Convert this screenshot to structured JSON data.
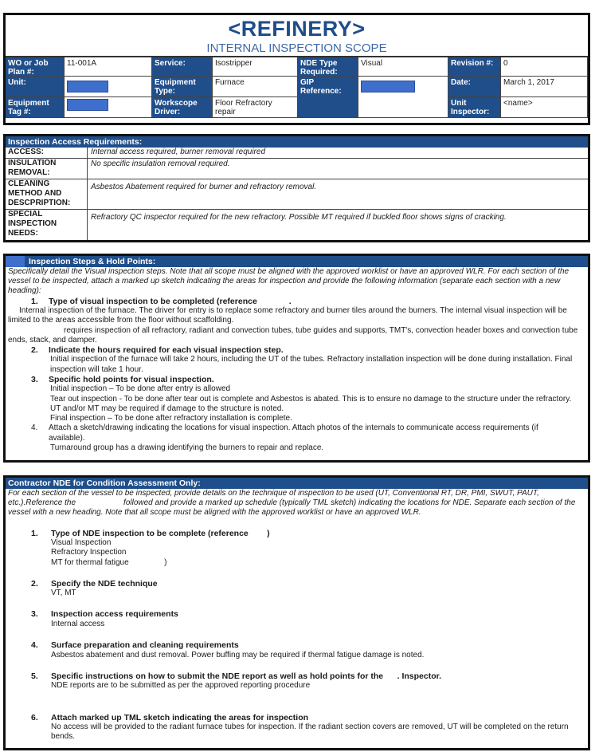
{
  "header": {
    "title": "<REFINERY>",
    "subtitle": "INTERNAL INSPECTION SCOPE",
    "fields": {
      "wo_label": "WO or Job Plan #:",
      "wo_value": "11-001A",
      "service_label": "Service:",
      "service_value": "Isostripper",
      "nde_type_label": "NDE Type Required:",
      "nde_type_value": "Visual",
      "revision_label": "Revision #:",
      "revision_value": "0",
      "unit_label": "Unit:",
      "unit_value": "[redacted]",
      "equipment_type_label": "Equipment Type:",
      "equipment_type_value": "Furnace",
      "gip_label": "GIP Reference:",
      "gip_value": "[redacted]",
      "date_label": "Date:",
      "date_value": "March 1, 2017",
      "equipment_tag_label": "Equipment Tag #:",
      "equipment_tag_value": "[redacted]",
      "workscope_label": "Workscope Driver:",
      "workscope_value": "Floor Refractory repair",
      "unit_inspector_label": "Unit Inspector:",
      "unit_inspector_value": "<name>"
    }
  },
  "access": {
    "title": "Inspection Access Requirements:",
    "rows": [
      {
        "label": "ACCESS:",
        "value": "Internal access required, burner removal required"
      },
      {
        "label": "INSULATION REMOVAL:",
        "value": "No specific insulation removal required."
      },
      {
        "label": "CLEANING METHOD AND DESCPRIPTION:",
        "value": "Asbestos Abatement required for burner and refractory removal."
      },
      {
        "label": "SPECIAL INSPECTION NEEDS:",
        "value": "Refractory QC inspector required for the new refractory.  Possible MT required if buckled floor shows signs of cracking."
      }
    ]
  },
  "steps": {
    "title": "Inspection Steps & Hold Points:",
    "intro": "Specifically detail the Visual inspection steps. Note that all scope must be aligned with the approved worklist or have an approved WLR. For each section of the vessel to be inspected, attach a marked up sketch indicating the areas for inspection and provide the following information (separate each section with a new heading):",
    "items": [
      {
        "num": "1.",
        "heading": "Type of visual inspection to be completed (reference",
        "heading_tail": ".",
        "body": [
          "Internal inspection of the furnace.  The driver for entry is to replace some refractory and burner tiles around the burners.  The internal visual inspection will be limited to the areas accessible from the floor without scaffolding.",
          "requires inspection of all refractory, radiant and convection tubes, tube guides and supports, TMT's, convection header boxes and convection tube ends, stack, and damper."
        ]
      },
      {
        "num": "2.",
        "heading": "Indicate the hours required for each visual inspection step.",
        "body": [
          "Initial inspection of the furnace will take 2 hours, including the UT of the tubes.  Refractory installation inspection will be done during installation.  Final inspection will take 1 hour."
        ]
      },
      {
        "num": "3.",
        "heading": "Specific hold points for visual inspection.",
        "body": [
          "Initial inspection – To be done after entry is allowed",
          "Tear out inspection  - To be done after tear out is complete and Asbestos is abated.  This is to ensure no damage to the structure under the refractory. UT and/or MT may be required if damage to the structure is noted.",
          "Final inspection – To be done after refractory installation is complete."
        ]
      },
      {
        "num": "4.",
        "heading": "Attach a sketch/drawing indicating the locations for visual inspection. Attach photos of the internals to communicate access requirements (if available).",
        "body": [
          "Turnaround group has a drawing identifying the burners to repair and replace."
        ]
      }
    ]
  },
  "nde": {
    "title": "Contractor NDE for Condition Assessment Only:",
    "intro_part1": "For each section of the vessel to be inspected, provide details on the technique of inspection to be used (UT, Conventional RT, DR, PMI, SWUT, PAUT, etc.).Reference the",
    "intro_part2": "followed and provide a marked up schedule (typically TML sketch) indicating the locations for NDE. Separate each section of the vessel with a new heading. Note that all scope must be aligned with the approved worklist or have an approved WLR.",
    "items": [
      {
        "num": "1.",
        "heading": "Type of NDE inspection to be complete (reference        )",
        "body": [
          "Visual Inspection",
          "Refractory Inspection",
          "MT for thermal fatigue                )"
        ]
      },
      {
        "num": "2.",
        "heading": "Specify the NDE technique",
        "body": [
          "VT, MT"
        ]
      },
      {
        "num": "3.",
        "heading": "Inspection access requirements",
        "body": [
          "Internal access"
        ]
      },
      {
        "num": "4.",
        "heading": "Surface preparation and cleaning requirements",
        "body": [
          "Asbestos abatement and dust removal.  Power buffing may be required if thermal fatigue damage is noted."
        ]
      },
      {
        "num": "5.",
        "heading": "Specific instructions on how to submit the NDE report as well as hold points for the      . Inspector.",
        "body": [
          "NDE reports are to be submitted as per the approved reporting procedure"
        ]
      },
      {
        "num": "6.",
        "heading": "Attach marked up TML sketch indicating the areas for inspection",
        "body": [
          "No access will be provided to the radiant furnace tubes for inspection.  If the radiant section covers are removed, UT will be completed on the return bends."
        ]
      }
    ]
  }
}
